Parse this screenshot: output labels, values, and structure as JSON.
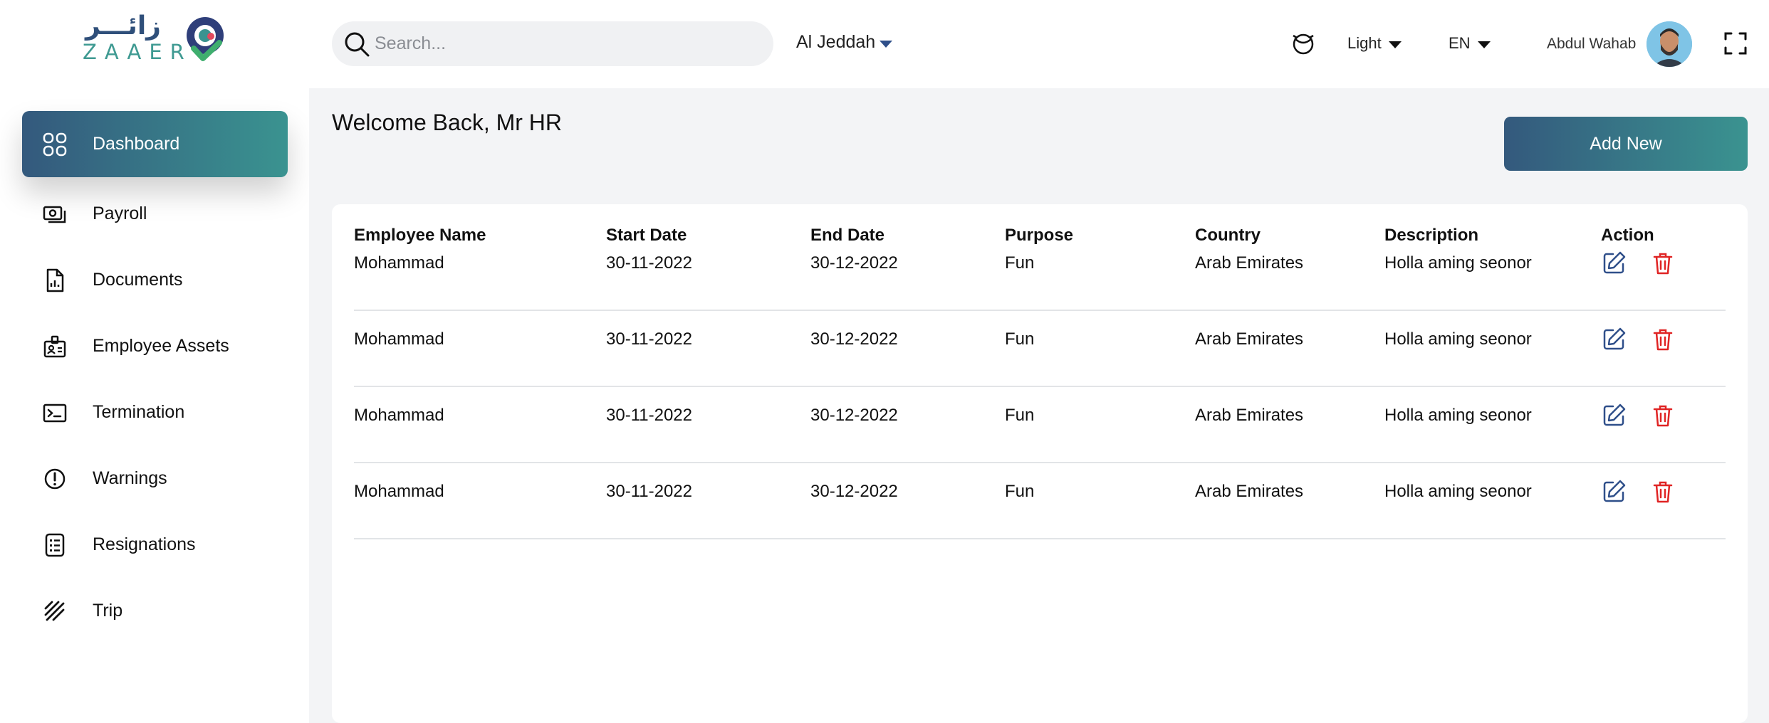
{
  "brand": {
    "logo_arabic": "زائـــر",
    "logo_latin": "ZAAER"
  },
  "header": {
    "search_placeholder": "Search...",
    "location": "Al Jeddah",
    "theme": "Light",
    "language": "EN",
    "user_name": "Abdul Wahab",
    "icons": [
      "search-icon",
      "globe-icon",
      "chevron-down-icon",
      "avatar",
      "fullscreen-icon"
    ]
  },
  "sidebar": {
    "items": [
      {
        "label": "Dashboard",
        "icon": "grid-icon",
        "active": true
      },
      {
        "label": "Payroll",
        "icon": "payroll-icon"
      },
      {
        "label": "Documents",
        "icon": "document-icon"
      },
      {
        "label": "Employee Assets",
        "icon": "id-badge-icon"
      },
      {
        "label": "Termination",
        "icon": "terminal-icon"
      },
      {
        "label": "Warnings",
        "icon": "alert-icon"
      },
      {
        "label": "Resignations",
        "icon": "checklist-icon"
      },
      {
        "label": "Trip",
        "icon": "stripes-icon"
      }
    ]
  },
  "main": {
    "welcome": "Welcome Back, Mr HR",
    "add_button": "Add New"
  },
  "table": {
    "headers": [
      "Employee Name",
      "Start Date",
      "End Date",
      "Purpose",
      "Country",
      "Description",
      "Action"
    ],
    "rows": [
      [
        "Mohammad",
        "30-11-2022",
        "30-12-2022",
        "Fun",
        "Arab Emirates",
        "Holla aming seonor"
      ],
      [
        "Mohammad",
        "30-11-2022",
        "30-12-2022",
        "Fun",
        "Arab Emirates",
        "Holla aming seonor"
      ],
      [
        "Mohammad",
        "30-11-2022",
        "30-12-2022",
        "Fun",
        "Arab Emirates",
        "Holla aming seonor"
      ],
      [
        "Mohammad",
        "30-11-2022",
        "30-12-2022",
        "Fun",
        "Arab Emirates",
        "Holla aming seonor"
      ]
    ],
    "action_icons": [
      "edit-icon",
      "trash-icon"
    ]
  },
  "colors": {
    "accent_start": "#34597d",
    "accent_end": "#3a9390",
    "delete": "#e02424",
    "edit": "#2f4f8a",
    "page_bg": "#f3f4f6"
  }
}
